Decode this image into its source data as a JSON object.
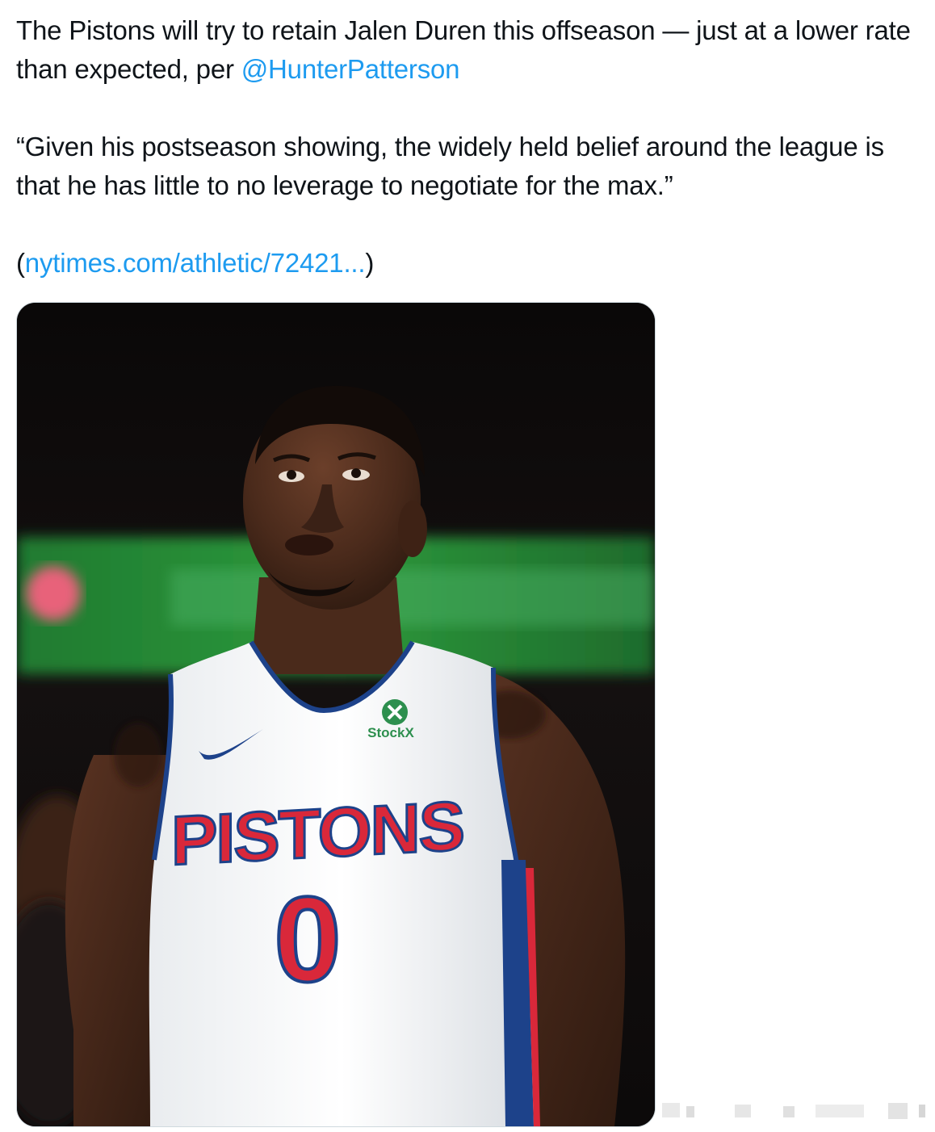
{
  "tweet": {
    "line1": "The Pistons will try to retain Jalen Duren this offseason — just at a lower rate than expected, per ",
    "mention": "@HunterPatterson",
    "quote": "“Given his postseason showing, the widely held belief around the league is that he has little to no leverage to negotiate for the max.”",
    "link_open": "(",
    "link_text": "nytimes.com/athletic/72421...",
    "link_close": ")"
  },
  "media": {
    "sponsor": "StockX",
    "team": "PISTONS",
    "number": "0"
  },
  "colors": {
    "link": "#1d9bf0",
    "text": "#0f1419",
    "jersey_red": "#d9283a",
    "jersey_blue": "#1d428a"
  }
}
